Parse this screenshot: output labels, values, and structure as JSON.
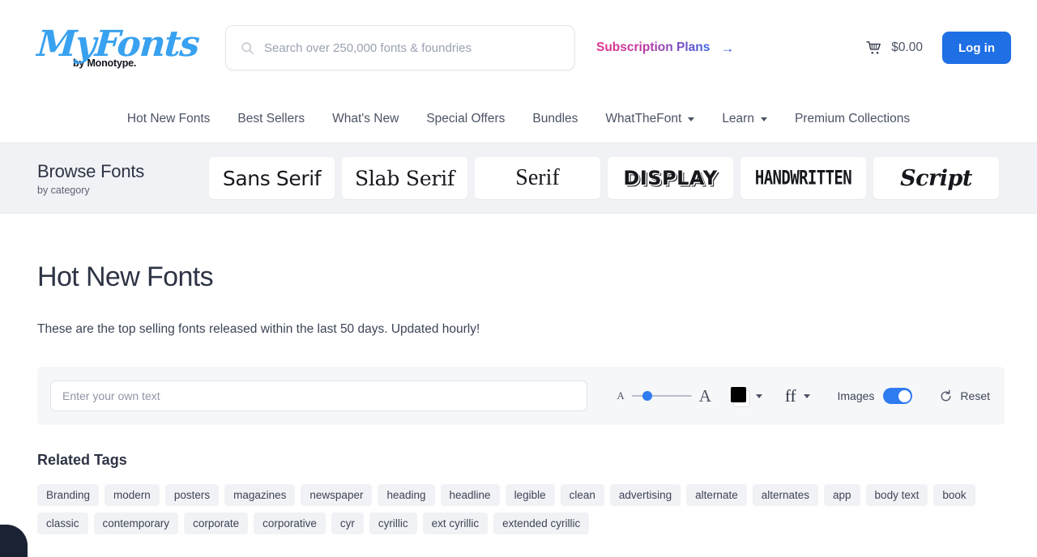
{
  "header": {
    "logo": {
      "mark": "MyFonts",
      "sub": "by Monotype."
    },
    "search": {
      "placeholder": "Search over 250,000 fonts & foundries",
      "value": "",
      "icon": "search-icon"
    },
    "subscription": {
      "label": "Subscription Plans",
      "arrow": "→"
    },
    "cart": {
      "icon": "cart-icon",
      "total": "$0.00"
    },
    "login": {
      "label": "Log in"
    }
  },
  "nav": {
    "items": [
      {
        "label": "Hot New Fonts",
        "dropdown": false
      },
      {
        "label": "Best Sellers",
        "dropdown": false
      },
      {
        "label": "What's New",
        "dropdown": false
      },
      {
        "label": "Special Offers",
        "dropdown": false
      },
      {
        "label": "Bundles",
        "dropdown": false
      },
      {
        "label": "WhatTheFont",
        "dropdown": true
      },
      {
        "label": "Learn",
        "dropdown": true
      },
      {
        "label": "Premium Collections",
        "dropdown": false
      }
    ]
  },
  "browse": {
    "title": "Browse Fonts",
    "subtitle": "by category",
    "categories": [
      {
        "label": "Sans Serif",
        "style": "cat-sans"
      },
      {
        "label": "Slab Serif",
        "style": "cat-slab"
      },
      {
        "label": "Serif",
        "style": "cat-serif"
      },
      {
        "label": "DISPLAY",
        "style": "cat-display"
      },
      {
        "label": "HANDWRITTEN",
        "style": "cat-hand"
      },
      {
        "label": "Script",
        "style": "cat-script"
      }
    ]
  },
  "main": {
    "title": "Hot New Fonts",
    "description": "These are the top selling fonts released within the last 50 days. Updated hourly!"
  },
  "toolbar": {
    "sample_text": {
      "placeholder": "Enter your own text",
      "value": ""
    },
    "size_slider": {
      "small_label": "A",
      "large_label": "A",
      "value": 18
    },
    "color": {
      "swatch": "#000000",
      "icon": "chevron-down-icon"
    },
    "font_features": {
      "glyph": "ff",
      "icon": "chevron-down-icon"
    },
    "images": {
      "label": "Images",
      "enabled": true
    },
    "reset": {
      "label": "Reset",
      "icon": "reset-circular-arrow-icon"
    }
  },
  "tags": {
    "title": "Related Tags",
    "items": [
      "Branding",
      "modern",
      "posters",
      "magazines",
      "newspaper",
      "heading",
      "headline",
      "legible",
      "clean",
      "advertising",
      "alternate",
      "alternates",
      "app",
      "body text",
      "book",
      "classic",
      "contemporary",
      "corporate",
      "corporative",
      "cyr",
      "cyrillic",
      "ext cyrillic",
      "extended cyrillic"
    ]
  },
  "colors": {
    "accent_blue": "#1f6fe5",
    "toggle_on": "#2f7bf0",
    "logo_blue": "#38a1f0",
    "band_bg": "#f1f2f5",
    "text_primary": "#2e3445"
  }
}
